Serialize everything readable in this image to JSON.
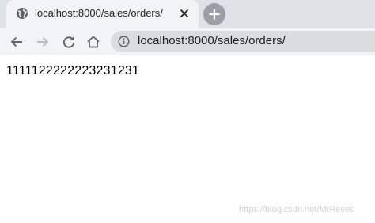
{
  "browser": {
    "tab": {
      "title": "localhost:8000/sales/orders/",
      "favicon": "globe-icon"
    },
    "new_tab": {
      "icon": "plus-icon"
    },
    "nav": {
      "back": {
        "icon": "back-arrow-icon"
      },
      "forward": {
        "icon": "forward-arrow-icon"
      },
      "reload": {
        "icon": "reload-icon"
      },
      "home": {
        "icon": "home-icon"
      }
    },
    "omnibox": {
      "url": "localhost:8000/sales/orders/",
      "icon": "info-icon"
    }
  },
  "page": {
    "body_text": "1111122222223231231"
  },
  "watermark": {
    "text": "https://blog.csdn.net/MrReeed"
  },
  "colors": {
    "tabstrip_bg": "#dee1e6",
    "toolbar_bg": "#f1f3f4",
    "omnibox_bg": "#dadcdf",
    "icon": "#5f6368",
    "icon_disabled": "#b8babd"
  }
}
